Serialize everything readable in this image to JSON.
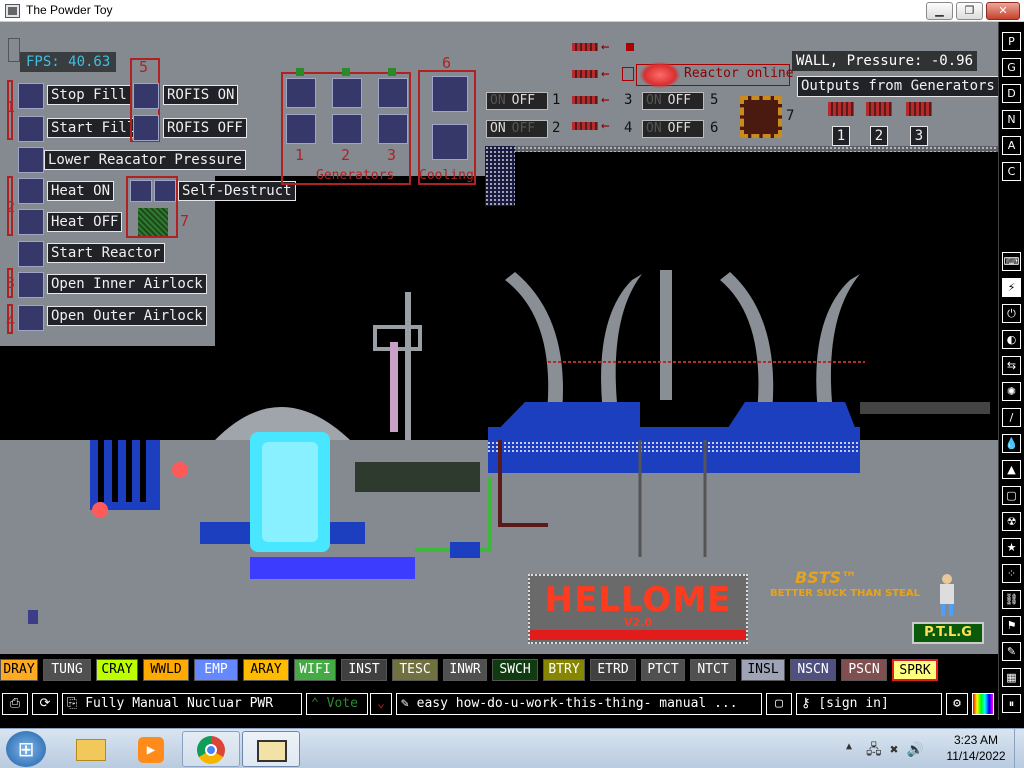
{
  "window": {
    "title": "The Powder Toy",
    "min_glyph": "▁",
    "max_glyph": "❐",
    "close_glyph": "✕"
  },
  "hud": {
    "fps": "FPS: 40.63",
    "pressure": "WALL, Pressure: -0.96",
    "outputs_label": "Outputs from Generators.",
    "reactor_status": "Reactor online"
  },
  "controls": {
    "buttons": [
      "Stop Fill",
      "Start Fill",
      "Lower Reacator Pressure",
      "Heat ON",
      "Heat OFF",
      "Start Reactor",
      "Open Inner Airlock",
      "Open Outer Airlock"
    ],
    "rofis_on": "ROFIS ON",
    "rofis_off": "ROFIS OFF",
    "self_destruct": "Self-Destruct",
    "group_labels": [
      "1",
      "2",
      "3",
      "4"
    ],
    "group5": "5",
    "group6": "6",
    "group7": "7",
    "generators_label": "Generators",
    "cooling_label": "Cooling",
    "gen_numbers": [
      "1",
      "2",
      "3"
    ]
  },
  "toggles": {
    "on": "ON",
    "off": "OFF",
    "numbers": [
      "1",
      "2",
      "5",
      "6"
    ],
    "arrow_numbers": [
      "3",
      "4"
    ],
    "ind7": "7",
    "arrow": "←",
    "out_numbers": [
      "1",
      "2",
      "3"
    ]
  },
  "scene": {
    "logo_title": "HELLOME",
    "logo_version": "V2.0",
    "bsts_title": "BSTS™",
    "bsts_subtitle": "BETTER SUCK THAN STEAL",
    "ptlg": "P.T.L.G"
  },
  "sidebar": [
    "P",
    "G",
    "D",
    "N",
    "A",
    "C"
  ],
  "elements": [
    {
      "label": "DRAY",
      "bg": "#ffaa22",
      "fg": "#000000"
    },
    {
      "label": "TUNG",
      "bg": "#505050",
      "fg": "#ffffff"
    },
    {
      "label": "CRAY",
      "bg": "#bbff00",
      "fg": "#000000"
    },
    {
      "label": "WWLD",
      "bg": "#ffaa00",
      "fg": "#000000"
    },
    {
      "label": "EMP",
      "bg": "#6688ff",
      "fg": "#ffffff"
    },
    {
      "label": "ARAY",
      "bg": "#ffbb00",
      "fg": "#000000"
    },
    {
      "label": "WIFI",
      "bg": "#44aa44",
      "fg": "#ffffff"
    },
    {
      "label": "INST",
      "bg": "#404040",
      "fg": "#ffffff"
    },
    {
      "label": "TESC",
      "bg": "#707040",
      "fg": "#ffffff"
    },
    {
      "label": "INWR",
      "bg": "#505050",
      "fg": "#ffffff"
    },
    {
      "label": "SWCH",
      "bg": "#103b11",
      "fg": "#ffffff"
    },
    {
      "label": "BTRY",
      "bg": "#868600",
      "fg": "#ffffff"
    },
    {
      "label": "ETRD",
      "bg": "#404040",
      "fg": "#ffffff"
    },
    {
      "label": "PTCT",
      "bg": "#505050",
      "fg": "#ffffff"
    },
    {
      "label": "NTCT",
      "bg": "#505050",
      "fg": "#ffffff"
    },
    {
      "label": "INSL",
      "bg": "#9ea3b6",
      "fg": "#000000"
    },
    {
      "label": "NSCN",
      "bg": "#505080",
      "fg": "#ffffff"
    },
    {
      "label": "PSCN",
      "bg": "#805050",
      "fg": "#ffffff"
    },
    {
      "label": "SPRK",
      "bg": "#ffff80",
      "fg": "#000000"
    }
  ],
  "bottombar": {
    "save_name": "Fully Manual Nucluar PWR",
    "vote": "Vote",
    "tags": "easy how-do-u-work-this-thing- manual ...",
    "sign_in": "[sign in]",
    "open_glyph": "⎙",
    "reload_glyph": "⟳",
    "report_glyph": "⎘",
    "tag_glyph": "✎",
    "doc_glyph": "▢",
    "key_glyph": "⚷",
    "pause_glyph": "⏸"
  },
  "taskbar": {
    "time": "3:23 AM",
    "date": "11/14/2022",
    "start_glyph": "⊞",
    "tray_arrow": "▲",
    "tray_icons": "🖧 ✖ 🔊"
  },
  "colors": {
    "grey_panel": "#858a90",
    "red_frame": "#b02222",
    "button_bg": "#36386a",
    "reactor_glow": "#48e6ff"
  }
}
